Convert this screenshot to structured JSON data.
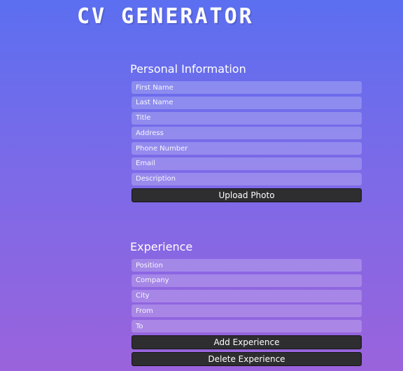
{
  "app": {
    "title": "CV GENERATOR"
  },
  "personal": {
    "heading": "Personal Information",
    "fields": [
      {
        "placeholder": "First Name"
      },
      {
        "placeholder": "Last Name"
      },
      {
        "placeholder": "Title"
      },
      {
        "placeholder": "Address"
      },
      {
        "placeholder": "Phone Number"
      },
      {
        "placeholder": "Email"
      },
      {
        "placeholder": "Description"
      }
    ],
    "upload_label": "Upload Photo"
  },
  "experience": {
    "heading": "Experience",
    "fields": [
      {
        "placeholder": "Position"
      },
      {
        "placeholder": "Company"
      },
      {
        "placeholder": "City"
      },
      {
        "placeholder": "From"
      },
      {
        "placeholder": "To"
      }
    ],
    "add_label": "Add Experience",
    "delete_label": "Delete Experience"
  },
  "colors": {
    "background_top": "#5b6ff0",
    "background_bottom": "#9a63dc",
    "button": "#2e2e30"
  }
}
